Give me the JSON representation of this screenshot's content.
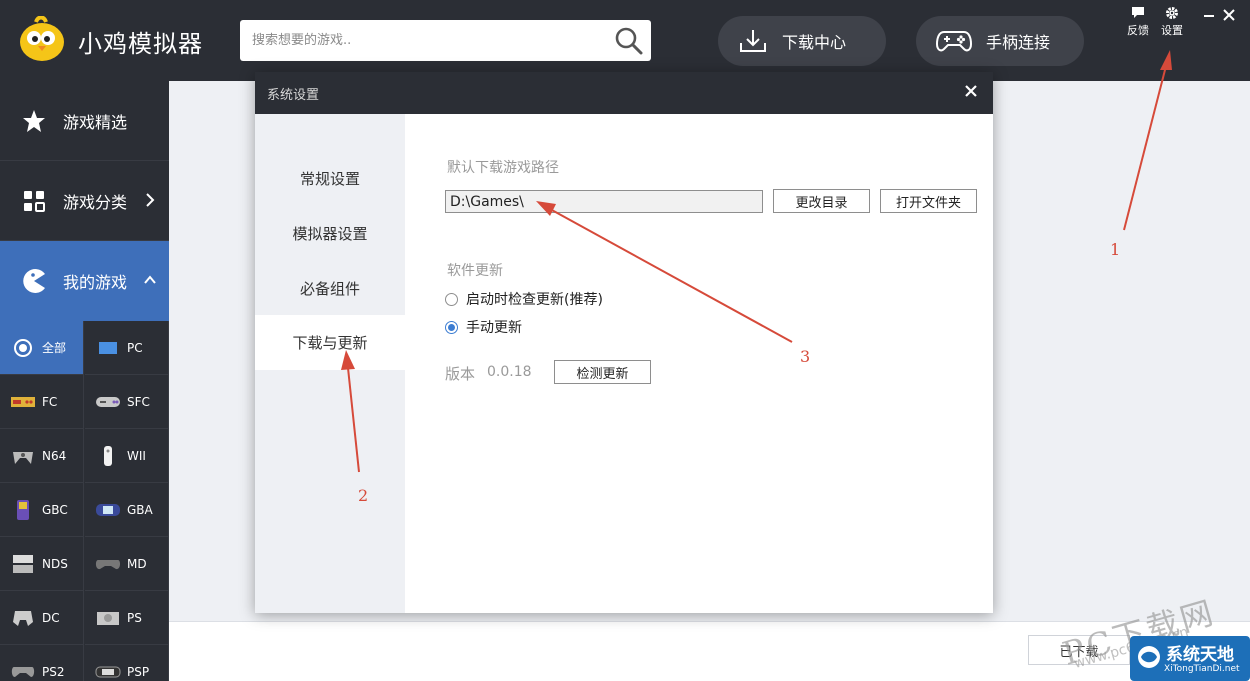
{
  "app": {
    "title": "小鸡模拟器",
    "search_placeholder": "搜索想要的游戏..",
    "download_center": "下载中心",
    "gamepad_connect": "手柄连接",
    "feedback": "反馈",
    "settings": "设置"
  },
  "sidebar": {
    "featured": "游戏精选",
    "category": "游戏分类",
    "my_games": "我的游戏",
    "platforms": [
      "全部",
      "PC",
      "FC",
      "SFC",
      "N64",
      "WII",
      "GBC",
      "GBA",
      "NDS",
      "MD",
      "DC",
      "PS",
      "PS2",
      "PSP"
    ]
  },
  "content": {
    "downloaded_button": "已下载"
  },
  "dialog": {
    "title": "系统设置",
    "menu": [
      "常规设置",
      "模拟器设置",
      "必备组件",
      "下载与更新"
    ],
    "active_menu_index": 3,
    "download_path_label": "默认下载游戏路径",
    "download_path_value": "D:\\Games\\",
    "change_dir_button": "更改目录",
    "open_folder_button": "打开文件夹",
    "update_label": "软件更新",
    "update_options": [
      "启动时检查更新(推荐)",
      "手动更新"
    ],
    "selected_update_option": 1,
    "version_label": "版本",
    "version_value": "0.0.18",
    "check_update_button": "检测更新"
  },
  "annotations": [
    "1",
    "2",
    "3"
  ],
  "watermark": {
    "text": "PC下载网",
    "url": "www.pc6.com.cn",
    "logo_title": "系统天地",
    "logo_sub": "XiTongTianDi.net"
  },
  "colors": {
    "dark": "#2b2e35",
    "accent_blue": "#3e6fba",
    "arrow_red": "#d64a3a"
  }
}
